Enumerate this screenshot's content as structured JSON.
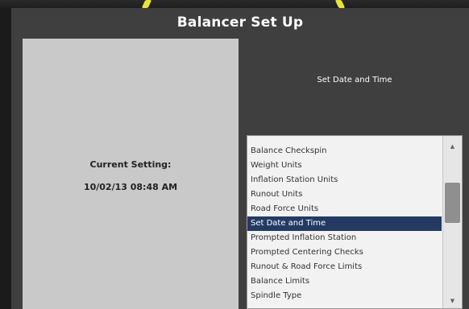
{
  "window": {
    "title": "Balancer Set Up"
  },
  "left_panel": {
    "label": "Current Setting:",
    "value": "10/02/13 08:48 AM"
  },
  "right_panel": {
    "heading": "Set Date and Time"
  },
  "settings_list": {
    "items": [
      "Balance Checkspin",
      "Weight Units",
      "Inflation Station Units",
      "Runout Units",
      "Road Force Units",
      "Set Date and Time",
      "Prompted Inflation Station",
      "Prompted Centering Checks",
      "Runout & Road Force Limits",
      "Balance Limits",
      "Spindle Type"
    ],
    "selected": "Set Date and Time"
  },
  "colors": {
    "selection": "#243a63",
    "panel": "#c9c9c9",
    "background": "#3f3f3f",
    "accent": "#e8e23a"
  },
  "icons": {
    "scroll_up": "chevron-up-icon",
    "scroll_down": "chevron-down-icon"
  }
}
